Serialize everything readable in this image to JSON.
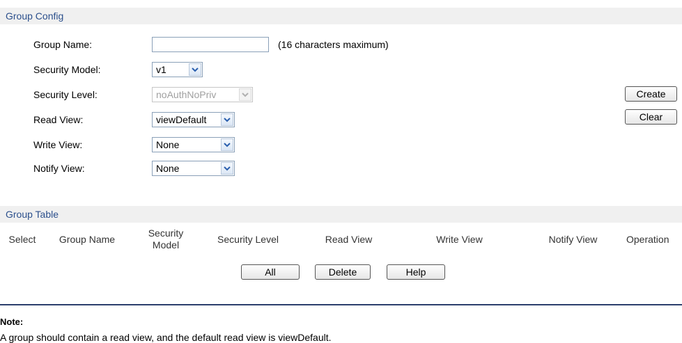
{
  "group_config": {
    "title": "Group Config",
    "group_name_label": "Group Name:",
    "group_name_value": "",
    "group_name_hint": "(16 characters maximum)",
    "security_model_label": "Security Model:",
    "security_model_value": "v1",
    "security_level_label": "Security Level:",
    "security_level_value": "noAuthNoPriv",
    "read_view_label": "Read View:",
    "read_view_value": "viewDefault",
    "write_view_label": "Write View:",
    "write_view_value": "None",
    "notify_view_label": "Notify View:",
    "notify_view_value": "None",
    "create_label": "Create",
    "clear_label": "Clear"
  },
  "group_table": {
    "title": "Group Table",
    "columns": [
      "Select",
      "Group Name",
      "Security Model",
      "Security Level",
      "Read View",
      "Write View",
      "Notify View",
      "Operation"
    ],
    "rows": [],
    "all_label": "All",
    "delete_label": "Delete",
    "help_label": "Help"
  },
  "note": {
    "title": "Note:",
    "text": "A group should contain a read view, and the default read view is viewDefault."
  },
  "colors": {
    "section_title": "#2b4f8c",
    "section_bg": "#f0f0f0",
    "note_rule": "#2b3f6c"
  }
}
